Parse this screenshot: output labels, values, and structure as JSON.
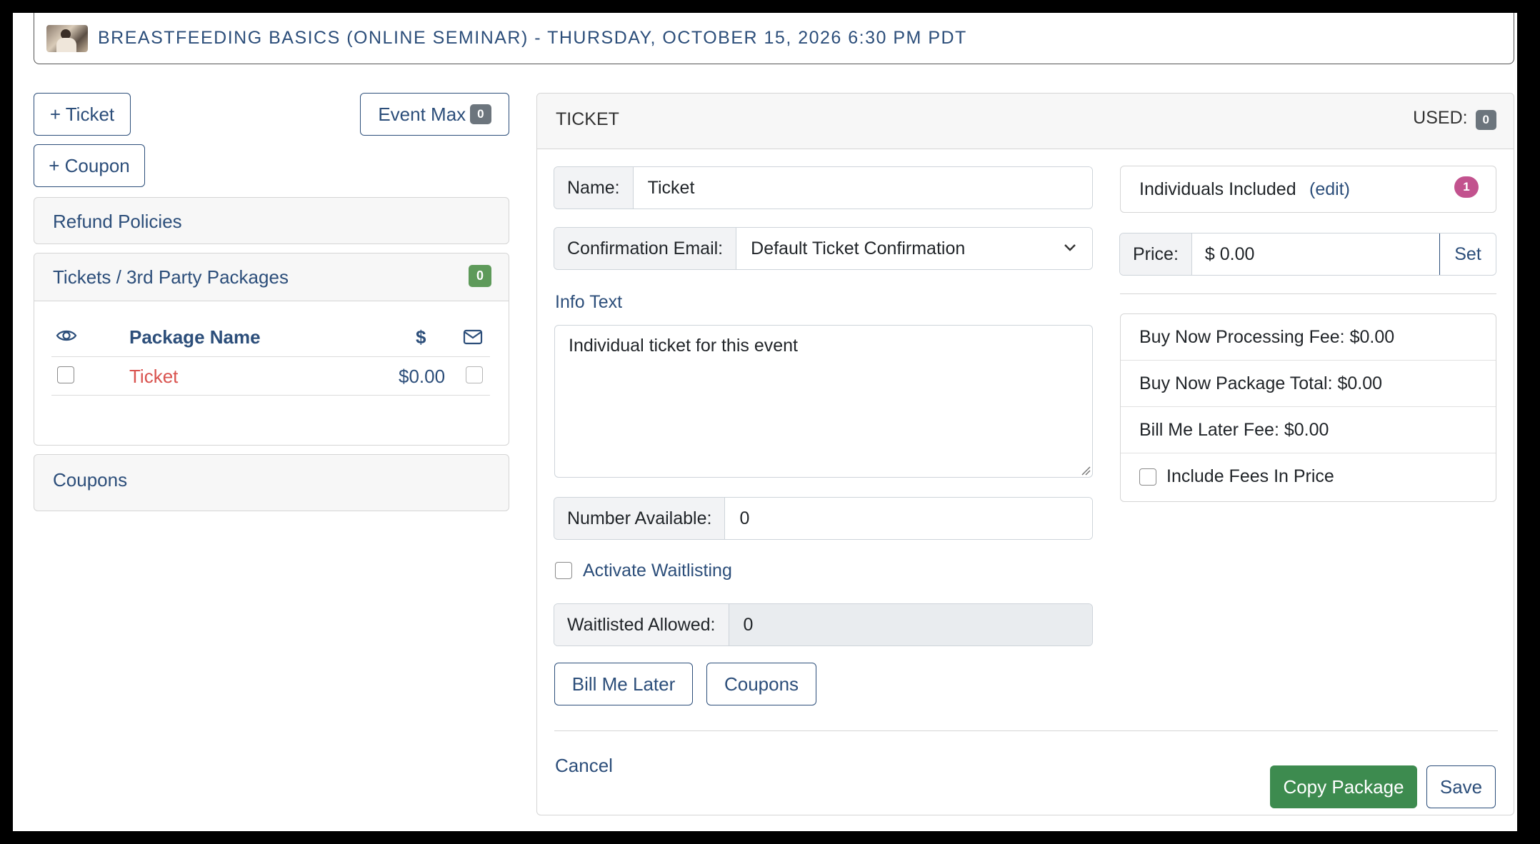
{
  "header": {
    "title": "BREASTFEEDING BASICS (ONLINE SEMINAR) - THURSDAY, OCTOBER 15, 2026 6:30 PM PDT"
  },
  "left": {
    "add_ticket_label": "+ Ticket",
    "add_coupon_label": "+ Coupon",
    "event_max_label": "Event Max",
    "event_max_count": "0",
    "refund_policies_label": "Refund Policies",
    "tickets_section": {
      "title": "Tickets / 3rd Party Packages",
      "count": "0",
      "columns": {
        "name": "Package Name",
        "price": "$"
      },
      "rows": [
        {
          "name": "Ticket",
          "price": "$0.00",
          "visible": false,
          "email": false
        }
      ]
    },
    "coupons_label": "Coupons"
  },
  "panel": {
    "title": "TICKET",
    "used_label": "USED:",
    "used_count": "0",
    "name_label": "Name:",
    "name_value": "Ticket",
    "confirmation_label": "Confirmation Email:",
    "confirmation_value": "Default Ticket Confirmation",
    "info_text_label": "Info Text",
    "info_text_value": "Individual ticket for this event",
    "number_available_label": "Number Available:",
    "number_available_value": "0",
    "activate_waitlisting_label": "Activate Waitlisting",
    "waitlisted_allowed_label": "Waitlisted Allowed:",
    "waitlisted_allowed_value": "0",
    "bill_me_later_label": "Bill Me Later",
    "coupons_button_label": "Coupons",
    "cancel_label": "Cancel",
    "copy_package_label": "Copy Package",
    "save_label": "Save",
    "individuals_label": "Individuals Included",
    "edit_label": "(edit)",
    "individuals_count": "1",
    "price_label": "Price:",
    "price_value": "$ 0.00",
    "set_label": "Set",
    "fees": {
      "processing": "Buy Now Processing Fee: $0.00",
      "package_total": "Buy Now Package Total: $0.00",
      "bill_later_fee": "Bill Me Later Fee: $0.00",
      "include_fees": "Include Fees In Price"
    }
  },
  "colors": {
    "primary": "#2c4e7a",
    "danger_text": "#d9534f",
    "success": "#3d8b4f",
    "badge_pink": "#c2528e"
  }
}
